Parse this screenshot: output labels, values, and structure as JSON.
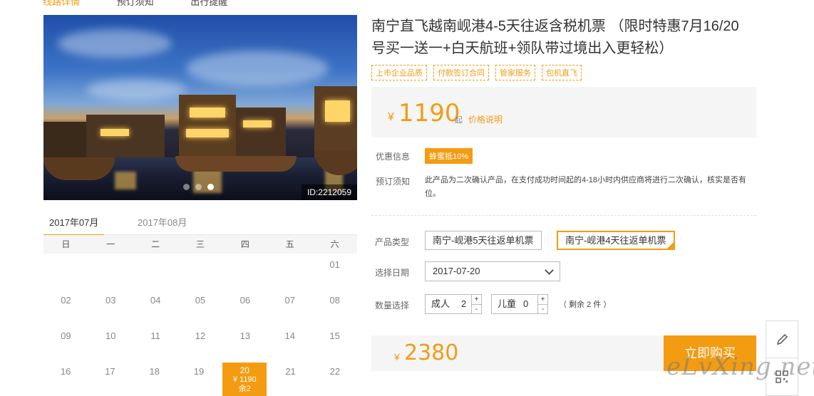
{
  "nav": {
    "items": [
      "线路详情",
      "预订须知",
      "出行提醒"
    ]
  },
  "photo": {
    "id_label": "ID:2212059",
    "slides": 3,
    "active_slide": 3
  },
  "calendar": {
    "tabs": [
      "2017年07月",
      "2017年08月"
    ],
    "weekdays": [
      "日",
      "一",
      "二",
      "三",
      "四",
      "五",
      "六"
    ],
    "rows": [
      [
        "",
        "",
        "",
        "",
        "",
        "",
        "01"
      ],
      [
        "02",
        "03",
        "04",
        "05",
        "06",
        "07",
        "08"
      ],
      [
        "09",
        "10",
        "11",
        "12",
        "13",
        "14",
        "15"
      ],
      [
        "16",
        "17",
        "18",
        "19",
        "20",
        "21",
        "22"
      ]
    ],
    "selected": {
      "day": "20",
      "price": "¥ 1190",
      "stock": "余2"
    }
  },
  "product": {
    "title": "南宁直飞越南岘港4-5天往返含税机票 （限时特惠7月16/20号买一送一+白天航班+领队带过境出入更轻松）",
    "tags": [
      "上市企业品质",
      "付款签订合同",
      "管家服务",
      "包机直飞"
    ],
    "price": {
      "currency": "¥",
      "amount": "1190",
      "suffix": "起",
      "explain": "价格说明"
    },
    "discount": {
      "label": "优惠信息",
      "badge": "蜂蜜抵10%"
    },
    "notice": {
      "label": "预订须知",
      "text": "此产品为二次确认产品，在支付成功时间起的4-18小时内供应商将进行二次确认，核实是否有位。"
    },
    "type": {
      "label": "产品类型",
      "options": [
        "南宁-岘港5天往返单机票",
        "南宁-岘港4天往返单机票"
      ],
      "selected_index": 1
    },
    "date": {
      "label": "选择日期",
      "value": "2017-07-20"
    },
    "quantity": {
      "label": "数量选择",
      "adult": {
        "label": "成人",
        "value": "2"
      },
      "child": {
        "label": "儿童",
        "value": "0"
      },
      "plus": "+",
      "minus": "-",
      "remain": "（ 剩余 2 件 ）"
    },
    "total": {
      "currency": "¥",
      "amount": "2380"
    },
    "buy_label": "立即购买"
  },
  "watermark": "eLvXing.net",
  "colors": {
    "accent": "#f39c12"
  }
}
